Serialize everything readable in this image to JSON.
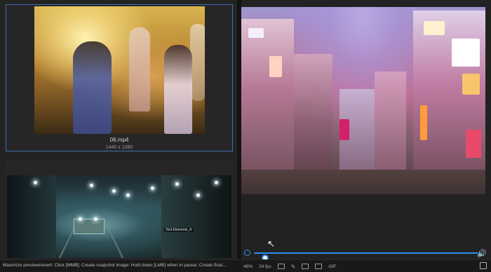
{
  "grid": {
    "tiles": [
      {
        "name": "06.mp4",
        "dimensions": "1440 x 1080",
        "selected": true
      },
      {
        "tag": "Text Elements_A"
      }
    ]
  },
  "player": {
    "seek_progress": 0.05,
    "accent_color": "#2f8cf0"
  },
  "status_bar": {
    "hint": "Maximize preview/revert: Click [MMB]; Create snapshot image: Hold down [LMB] when in pause; Create float...",
    "zoom": "46%",
    "fps": "24 fps",
    "gif_label": "GIF"
  },
  "icons": {
    "loop": "loop-icon",
    "volume": "volume-icon",
    "fullscreen": "fullscreen-icon"
  }
}
